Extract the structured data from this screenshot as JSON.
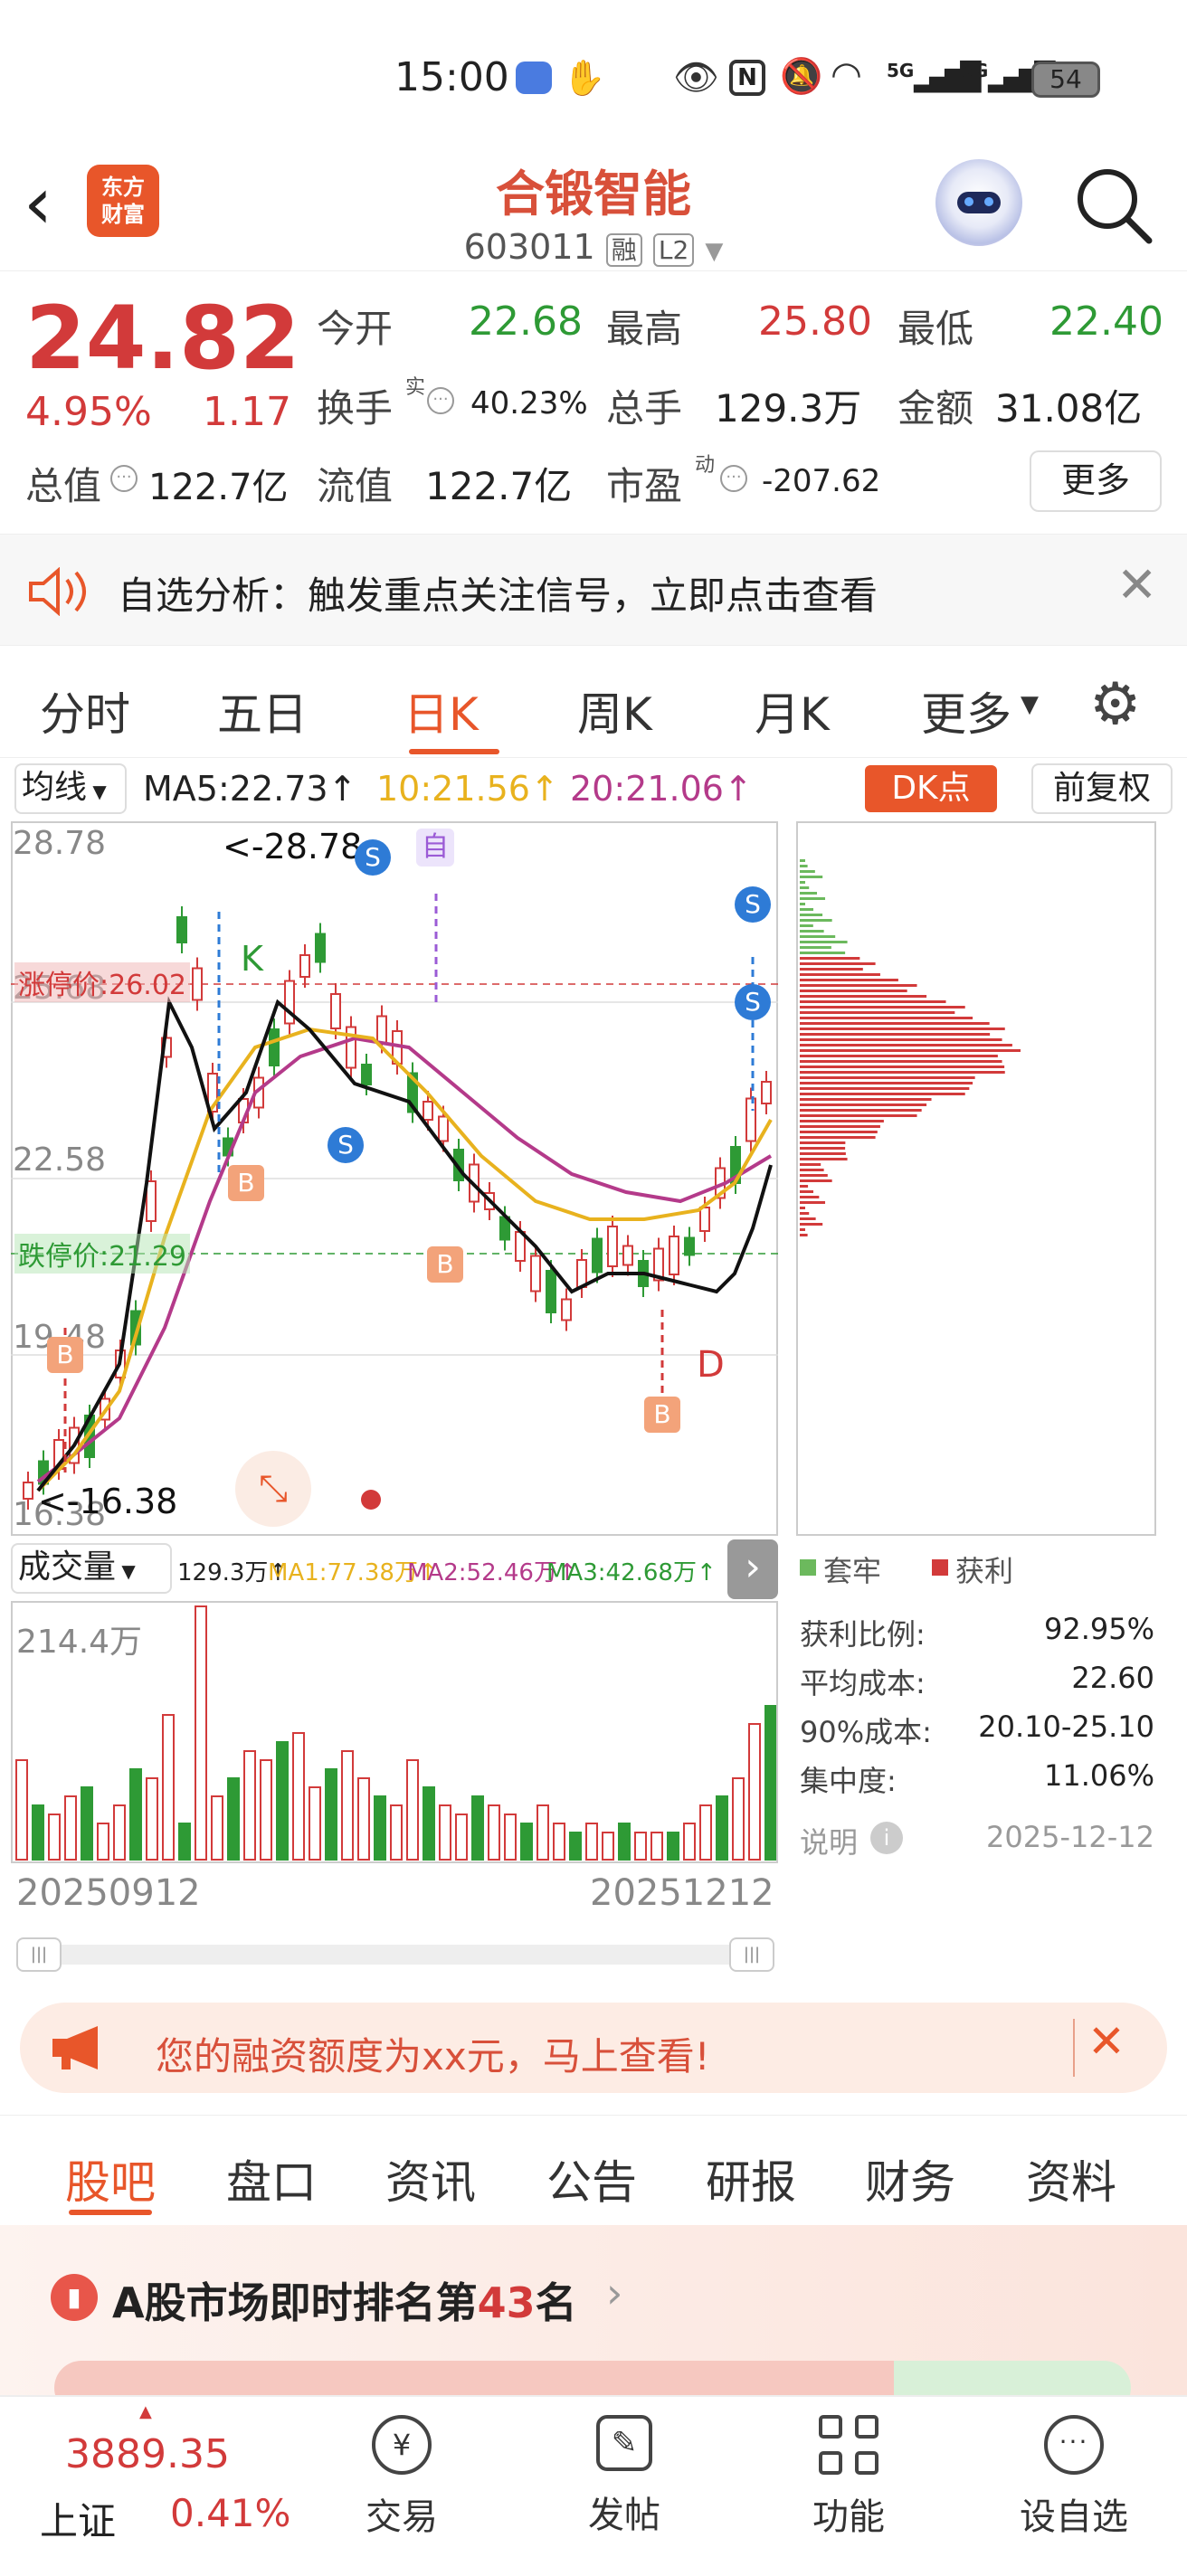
{
  "status": {
    "time": "15:00",
    "signal1": "5G",
    "signal2": "5G",
    "battery": "54"
  },
  "header": {
    "logo_line1": "东方",
    "logo_line2": "财富",
    "name": "合锻智能",
    "code": "603011",
    "tag1": "融",
    "tag2": "L2"
  },
  "quote": {
    "price": "24.82",
    "pct": "4.95%",
    "change": "1.17",
    "open_label": "今开",
    "open": "22.68",
    "high_label": "最高",
    "high": "25.80",
    "low_label": "最低",
    "low": "22.40",
    "turnover_label": "换手",
    "turnover_sup": "实",
    "turnover": "40.23%",
    "volume_label": "总手",
    "volume": "129.3万",
    "amount_label": "金额",
    "amount": "31.08亿",
    "mktcap_label": "总值",
    "mktcap": "122.7亿",
    "float_label": "流值",
    "float": "122.7亿",
    "pe_label": "市盈",
    "pe_sup": "动",
    "pe": "-207.62",
    "more": "更多"
  },
  "notice": {
    "text": "自选分析：触发重点关注信号，立即点击查看"
  },
  "chart_tabs": [
    "分时",
    "五日",
    "日K",
    "周K",
    "月K",
    "更多"
  ],
  "active_tab": "日K",
  "ma_bar": {
    "selector": "均线",
    "ma5": "MA5:22.73↑",
    "ma10": "10:21.56↑",
    "ma20": "20:21.06↑",
    "dk": "DK点",
    "adjust": "前复权"
  },
  "kline": {
    "y_top": "28.78",
    "y_2": "25.68",
    "y_3": "22.58",
    "y_4": "19.48",
    "y_bottom": "16.38",
    "limit_up": "涨停价:26.02",
    "limit_down": "跌停价:21.29",
    "max_note": "<-28.78",
    "min_note": "<-16.38",
    "marker_self": "自",
    "marker_k": "K",
    "marker_d": "D"
  },
  "volume_bar": {
    "selector": "成交量",
    "vol": "129.3万↑",
    "ma1": "MA1:77.38万↑",
    "ma2": "MA2:52.46万↑",
    "ma3": "MA3:42.68万↑",
    "y_top": "214.4万"
  },
  "dates": {
    "start": "20250912",
    "end": "20251212"
  },
  "chip": {
    "legend_trapped": "套牢",
    "legend_profit": "获利",
    "rows": [
      {
        "label": "获利比例:",
        "value": "92.95%"
      },
      {
        "label": "平均成本:",
        "value": "22.60"
      },
      {
        "label": "90%成本:",
        "value": "20.10-25.10"
      },
      {
        "label": "集中度:",
        "value": "11.06%"
      }
    ],
    "note_label": "说明",
    "note_date": "2025-12-12"
  },
  "promo": {
    "text": "您的融资额度为xx元，马上查看!"
  },
  "section_tabs": [
    "股吧",
    "盘口",
    "资讯",
    "公告",
    "研报",
    "财务",
    "资料"
  ],
  "ranking": {
    "prefix": "A股市场即时排名第",
    "rank": "43",
    "suffix": "名"
  },
  "bottom": {
    "index_value": "3889.35",
    "index_name": "上证",
    "index_pct": "0.41%",
    "items": [
      "交易",
      "发帖",
      "功能",
      "设自选"
    ]
  },
  "colors": {
    "up": "#d23a3a",
    "down": "#2e9a35",
    "accent": "#e8562a"
  }
}
